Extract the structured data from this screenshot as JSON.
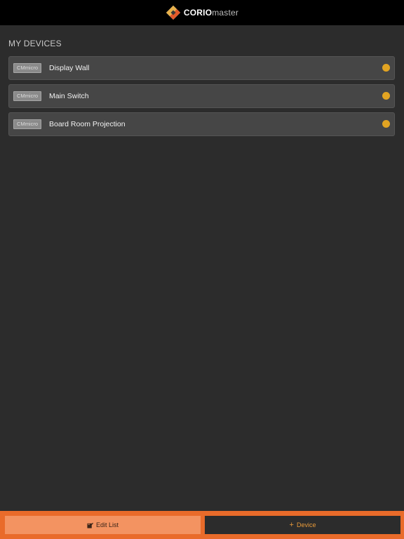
{
  "header": {
    "logo_bold": "CORIO",
    "logo_light": "master"
  },
  "section": {
    "title": "MY DEVICES"
  },
  "devices": [
    {
      "tag": "CMmicro",
      "name": "Display Wall",
      "status": "connected-pending"
    },
    {
      "tag": "CMmicro",
      "name": "Main Switch",
      "status": "connected-pending"
    },
    {
      "tag": "CMmicro",
      "name": "Board Room Projection",
      "status": "connected-pending"
    }
  ],
  "bottom_bar": {
    "edit_label": "Edit List",
    "add_label": "Device",
    "add_icon": "plus-icon",
    "edit_icon": "edit-icon"
  },
  "colors": {
    "accent": "#e96b2a",
    "status_dot": "#e2a422",
    "background": "#2c2c2c"
  }
}
